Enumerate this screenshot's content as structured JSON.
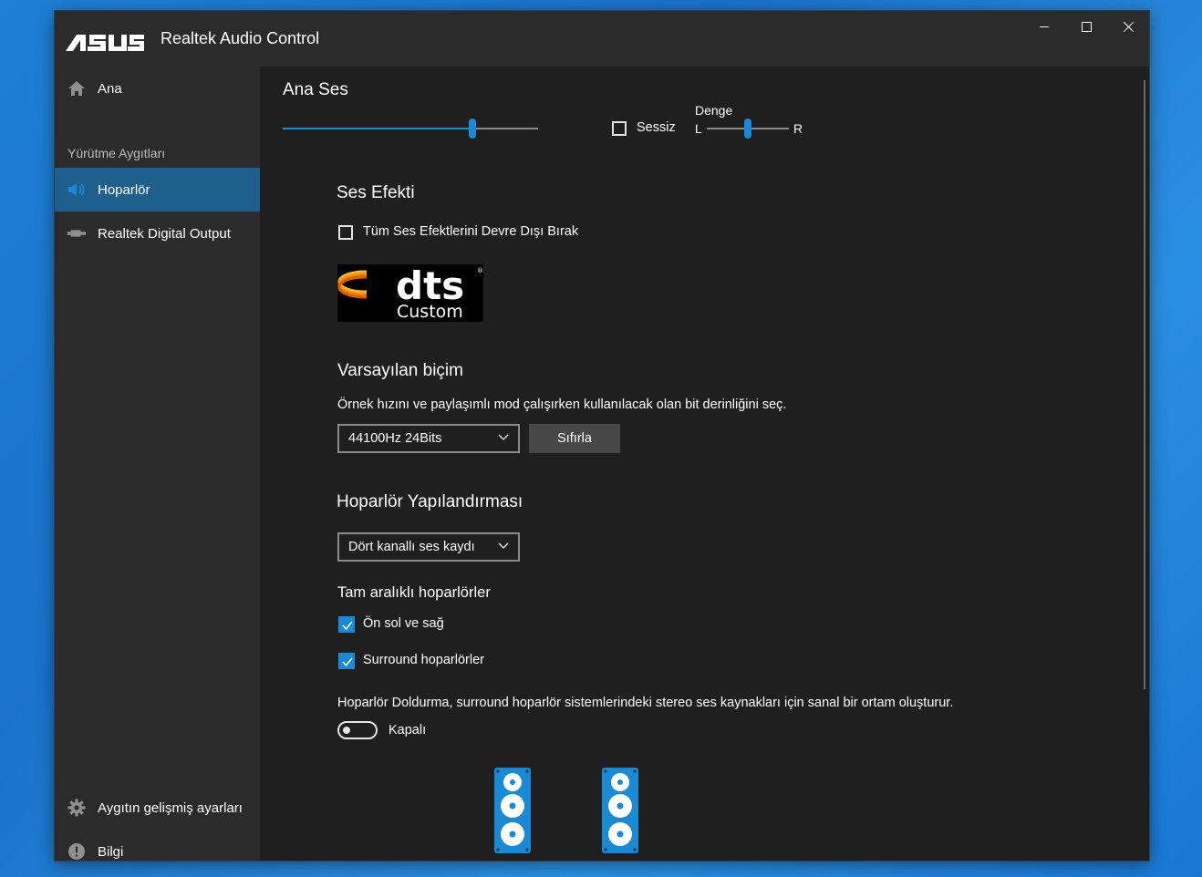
{
  "window": {
    "brand": "ASUS",
    "title": "Realtek Audio Control",
    "controls": [
      "minimize-icon",
      "maximize-icon",
      "close-icon"
    ]
  },
  "sidebar": {
    "home_label": "Ana",
    "section_label": "Yürütme Aygıtları",
    "devices": [
      {
        "label": "Hoparlör",
        "icon": "speaker-icon",
        "active": true
      },
      {
        "label": "Realtek Digital Output",
        "icon": "digital-output-icon",
        "active": false
      }
    ],
    "bottom": [
      {
        "label": "Aygıtın gelişmiş ayarları",
        "icon": "gear-icon"
      },
      {
        "label": "Bilgi",
        "icon": "info-icon"
      }
    ]
  },
  "main_volume": {
    "title": "Ana Ses",
    "level": 0.75,
    "mute_label": "Sessiz",
    "mute_checked": false,
    "balance_label": "Denge",
    "balance_left": "L",
    "balance_right": "R",
    "balance": 0.5
  },
  "sound_effect": {
    "title": "Ses Efekti",
    "disable_all_label": "Tüm Ses Efektlerini Devre Dışı Bırak",
    "disable_all_checked": false,
    "dts_logo_text": "dts",
    "dts_mode": "Custom"
  },
  "default_format": {
    "title": "Varsayılan biçim",
    "description": "Örnek hızını ve paylaşımlı mod çalışırken kullanılacak olan bit derinliğini seç.",
    "selected": "44100Hz 24Bits",
    "reset_label": "Sıfırla"
  },
  "speaker_config": {
    "title": "Hoparlör Yapılandırması",
    "selected": "Dört kanallı ses kaydı",
    "full_range_title": "Tam aralıklı hoparlörler",
    "front_label": "Ön sol ve sağ",
    "front_checked": true,
    "surround_label": "Surround hoparlörler",
    "surround_checked": true,
    "fill_description": "Hoparlör Doldurma, surround hoparlör sistemlerindeki stereo ses kaynakları için sanal bir ortam oluşturur.",
    "fill_state_label": "Kapalı",
    "fill_on": false
  },
  "colors": {
    "accent": "#1a8ad4",
    "active_nav": "#1f5f8e",
    "background": "#1f1f1f",
    "sidebar": "#2b2b2b"
  }
}
